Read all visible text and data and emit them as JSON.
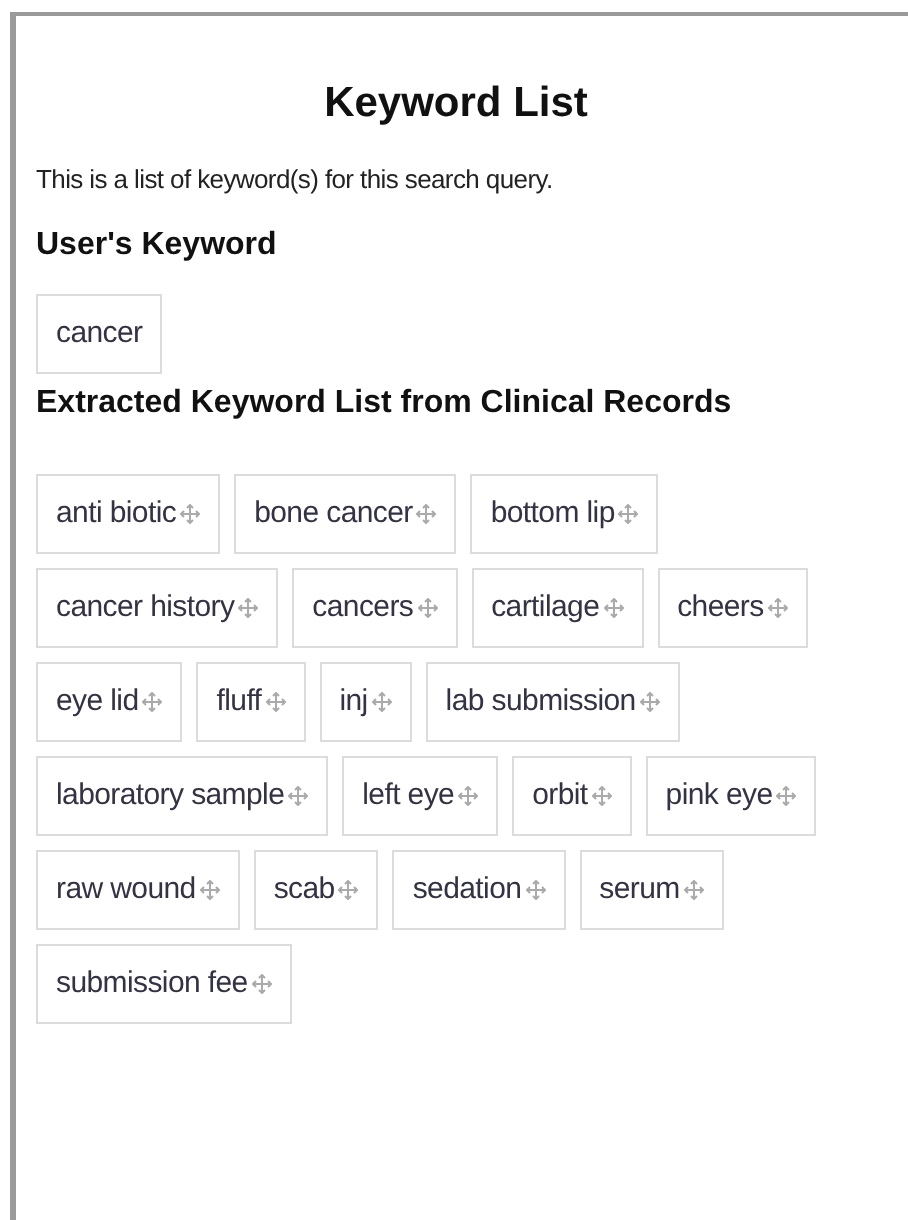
{
  "title": "Keyword List",
  "description": "This is a list of keyword(s) for this search query.",
  "user_keyword_heading": "User's Keyword",
  "user_keywords": [
    {
      "label": "cancer",
      "movable": false
    }
  ],
  "extracted_heading": "Extracted Keyword List from Clinical Records",
  "extracted_keywords": [
    {
      "label": "anti biotic",
      "movable": true
    },
    {
      "label": "bone cancer",
      "movable": true
    },
    {
      "label": "bottom lip",
      "movable": true
    },
    {
      "label": "cancer history",
      "movable": true
    },
    {
      "label": "cancers",
      "movable": true
    },
    {
      "label": "cartilage",
      "movable": true
    },
    {
      "label": "cheers",
      "movable": true
    },
    {
      "label": "eye lid",
      "movable": true
    },
    {
      "label": "fluff",
      "movable": true
    },
    {
      "label": "inj",
      "movable": true
    },
    {
      "label": "lab submission",
      "movable": true
    },
    {
      "label": "laboratory sample",
      "movable": true
    },
    {
      "label": "left eye",
      "movable": true
    },
    {
      "label": "orbit",
      "movable": true
    },
    {
      "label": "pink eye",
      "movable": true
    },
    {
      "label": "raw wound",
      "movable": true
    },
    {
      "label": "scab",
      "movable": true
    },
    {
      "label": "sedation",
      "movable": true
    },
    {
      "label": "serum",
      "movable": true
    },
    {
      "label": "submission fee",
      "movable": true
    }
  ]
}
